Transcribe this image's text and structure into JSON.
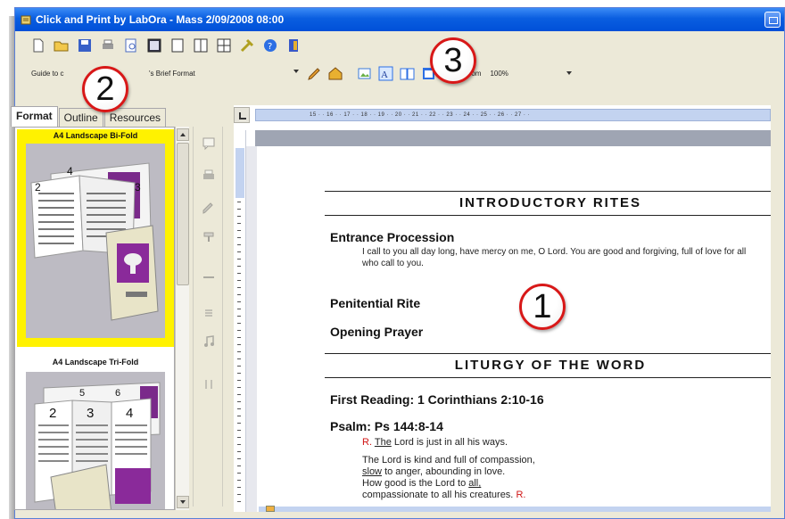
{
  "window": {
    "title": "Click and Print by LabOra - Mass 2/09/2008 08:00"
  },
  "toolbar2": {
    "guide_label": "Guide to c",
    "guide_value": "'s Brief Format",
    "zoom_label": "Zoom",
    "zoom_value": "100%"
  },
  "left_panel": {
    "tabs": [
      {
        "label": "Format",
        "active": true
      },
      {
        "label": "Outline",
        "active": false
      },
      {
        "label": "Resources",
        "active": false
      }
    ],
    "formats": [
      {
        "label": "A4 Landscape Bi-Fold",
        "selected": true
      },
      {
        "label": "A4 Landscape Tri-Fold",
        "selected": false
      }
    ],
    "thumb1_page_numbers": [
      "4",
      "2",
      "3"
    ],
    "thumb2_page_numbers": [
      "5",
      "6",
      "2",
      "3",
      "4"
    ]
  },
  "ruler": {
    "marks": "15 · · 16 · · 17 · · 18 · · 19 · · 20 · · 21 · · 22 · · 23 · · 24 · · 25 · · 26 · · 27 · ·"
  },
  "document": {
    "sections": [
      {
        "title": "INTRODUCTORY RITES"
      },
      {
        "title": "LITURGY OF THE WORD"
      }
    ],
    "entrance_heading": "Entrance Procession",
    "entrance_text": "I call to you all day long, have mercy on me, O Lord. You are good and forgiving, full of love for all who call to you.",
    "penitential": "Penitential Rite",
    "opening_prayer": "Opening Prayer",
    "first_reading": "First Reading: 1 Corinthians 2:10-16",
    "psalm_heading": "Psalm: Ps 144:8-14",
    "psalm_response_marker": "R.",
    "psalm_response_the": "The",
    "psalm_response_rest": "Lord is just in all his ways.",
    "psalm_line1": "The Lord is kind and full of compassion,",
    "psalm_line2_u": "slow",
    "psalm_line2_rest": "to anger, abounding in love.",
    "psalm_line3_pre": "How good is the Lord to",
    "psalm_line3_u": "all,",
    "psalm_line4": "compassionate to all his creatures.",
    "psalm_line4_marker": "R."
  },
  "callouts": [
    "1",
    "2",
    "3"
  ],
  "colors": {
    "titlebar": "#0a5ee0",
    "selected_format_bg": "#fff200",
    "callout_ring": "#d81818",
    "response_marker": "#d01414"
  }
}
